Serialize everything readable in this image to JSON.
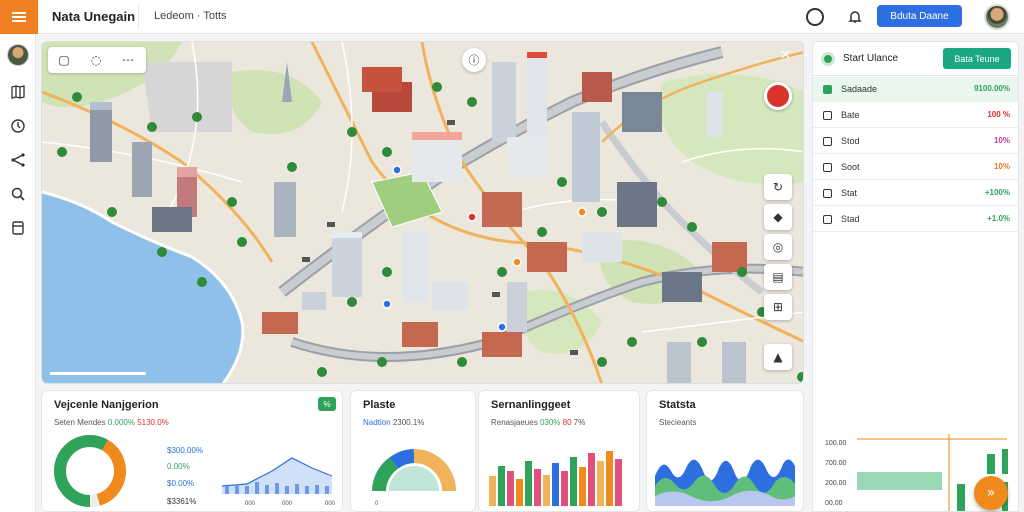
{
  "header": {
    "app_title": "Nata Unegain",
    "breadcrumb": "Ledeom · Totts",
    "action_button": "Bduta Daane"
  },
  "right_panel": {
    "title": "Start Ulance",
    "button": "Bata Teune",
    "rows": [
      {
        "label": "Sadaade",
        "value": "9100.00%"
      },
      {
        "label": "Bate",
        "value": "100 %"
      },
      {
        "label": "Stod",
        "value": "10%"
      },
      {
        "label": "Soot",
        "value": "10%"
      },
      {
        "label": "Stat",
        "value": "+100%"
      },
      {
        "label": "Stad",
        "value": "+1.0%"
      }
    ],
    "chart_ticks": [
      "100.00",
      "700.00",
      "200.00",
      "00.00"
    ]
  },
  "cards": {
    "vehicle": {
      "title": "Vejcenle Nanjgerion",
      "sub_label": "Seten Mendes",
      "sub_green": "0.000%",
      "sub_red": "5130.0%",
      "badge": "%",
      "legend": [
        "$300.00%",
        "0.00%",
        "$0.00%",
        "$3361%"
      ],
      "axis": [
        "000",
        "000",
        "000"
      ]
    },
    "plate": {
      "title": "Plaste",
      "sub_label": "Nadtion",
      "sub_value": "2300.1%",
      "axis": "0"
    },
    "summary": {
      "title": "Sernanlinggeet",
      "sub_label": "Renasjaeues",
      "sub_green": "030%",
      "sub_red": "80",
      "sub_value": "7%"
    },
    "stats": {
      "title": "Statsta",
      "sub_label": "Stecieants"
    }
  },
  "colors": {
    "accent_orange": "#f07f22",
    "primary_blue": "#2d6fe0",
    "teal": "#1aa786",
    "green": "#2fa35a",
    "red": "#d9342b"
  },
  "icons": {
    "menu": "hamburger-menu-icon",
    "clock": "clock-icon",
    "bell": "bell-icon",
    "fab": "double-chevron-right-icon"
  }
}
